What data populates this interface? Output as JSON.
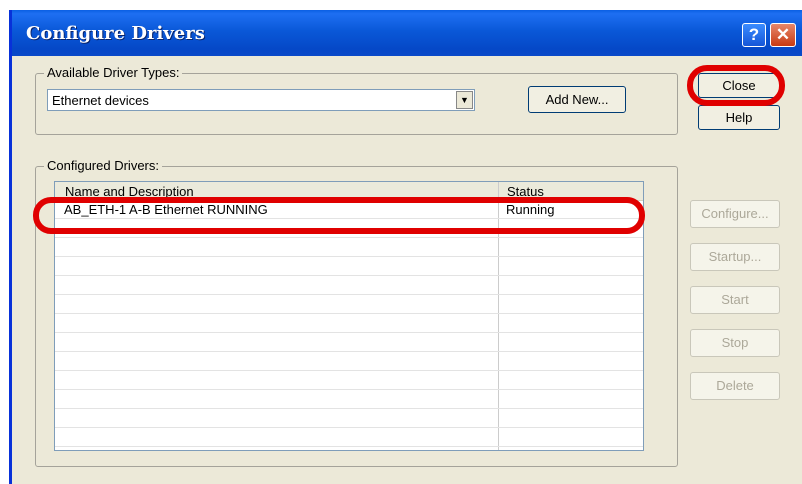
{
  "window": {
    "title": "Configure Drivers"
  },
  "titlebar": {
    "help_glyph": "?",
    "close_glyph": "✕"
  },
  "available": {
    "legend": "Available Driver Types:",
    "selected": "Ethernet devices",
    "add_new_label": "Add New..."
  },
  "configured": {
    "legend": "Configured Drivers:",
    "columns": [
      "Name and Description",
      "Status"
    ],
    "rows": [
      {
        "name": "AB_ETH-1  A-B Ethernet  RUNNING",
        "status": "Running"
      }
    ]
  },
  "buttons": {
    "close": "Close",
    "help": "Help",
    "configure": "Configure...",
    "startup": "Startup...",
    "start": "Start",
    "stop": "Stop",
    "delete": "Delete"
  },
  "annotation_color": "#e00000"
}
